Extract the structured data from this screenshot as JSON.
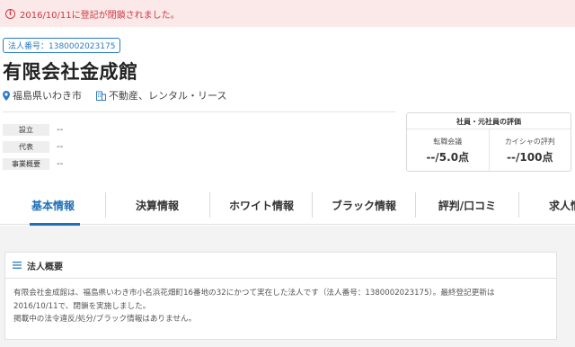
{
  "alert": {
    "text": "2016/10/11に登記が閉鎖されました。",
    "icon": "info-circle-icon",
    "color": "#d0373f"
  },
  "company": {
    "corp_number_badge": "法人番号：1380002023175",
    "name": "有限会社金成館",
    "location": "福島県いわき市",
    "industry": "不動産、レンタル・リース"
  },
  "info": {
    "rows": [
      {
        "label": "設立",
        "value": "--"
      },
      {
        "label": "代表",
        "value": "--"
      },
      {
        "label": "事業概要",
        "value": "--"
      }
    ]
  },
  "evaluation": {
    "title": "社員・元社員の評価",
    "items": [
      {
        "label": "転職会議",
        "value": "--/5.0点"
      },
      {
        "label": "カイシャの評判",
        "value": "--/100点"
      }
    ]
  },
  "tabs": [
    {
      "label": "基本情報",
      "active": true
    },
    {
      "label": "決算情報"
    },
    {
      "label": "ホワイト情報"
    },
    {
      "label": "ブラック情報"
    },
    {
      "label": "評判/口コミ"
    },
    {
      "label": "求人情"
    }
  ],
  "overview": {
    "heading": "法人概要",
    "line1": "有限会社金成館は、福島県いわき市小名浜花畑町16番地の32にかつて実在した法人です（法人番号：1380002023175）。最終登記更新は",
    "line2": "2016/10/11で、閉鎖を実施しました。",
    "line3": "掲載中の法令違反/処分/ブラック情報はありません。"
  },
  "colors": {
    "accent": "#1f6fb8",
    "alert_bg": "#fbe9e9"
  }
}
